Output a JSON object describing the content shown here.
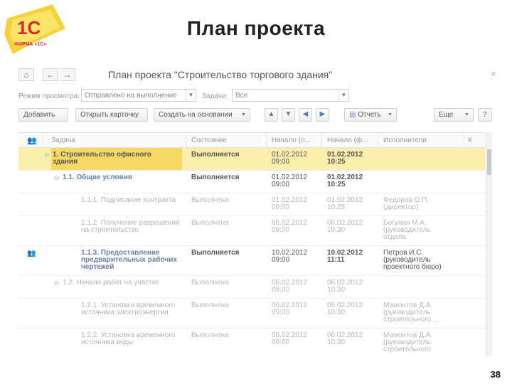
{
  "slide": {
    "title": "План проекта",
    "number": "38",
    "logo_text": "1С",
    "logo_sub": "ФИРМА «1С»"
  },
  "window": {
    "title": "План проекта \"Строительство торгового здания\""
  },
  "filters": {
    "mode_label": "Режим просмотра:",
    "mode_value": "Отправлено на выполнение",
    "tasks_label": "Задачи:",
    "tasks_value": "Все"
  },
  "toolbar": {
    "add": "Добавить",
    "open_card": "Открыть карточку",
    "create_based": "Создать на основании",
    "report": "Отчеть",
    "more": "Еще",
    "help": "?"
  },
  "columns": [
    "Задача",
    "Состояние",
    "Начало (п...",
    "Начало (ф...",
    "Исполнители",
    "К"
  ],
  "rows": [
    {
      "indent": 1,
      "tree": "⊖",
      "task": "1. Строительство офисного\nздания",
      "state": "Выполняется",
      "plan_start": "01.02.2012\n09:00",
      "fact_start": "01.02.2012\n10:25",
      "executor": "",
      "selected": true,
      "active": true,
      "user": false
    },
    {
      "indent": 2,
      "tree": "⊖",
      "task": "1.1. Общие условия",
      "state": "Выполняется",
      "plan_start": "01.02.2012\n09:00",
      "fact_start": "01.02.2012\n10:25",
      "executor": "",
      "selected": false,
      "active": true,
      "user": false
    },
    {
      "indent": 3,
      "tree": "",
      "task": "1.1.1. Подписание контракта",
      "state": "Выполнена",
      "plan_start": "01.02.2012\n09:00",
      "fact_start": "01.02.2012\n10:25",
      "executor": "Федоров О.П.\n(директор)",
      "selected": false,
      "active": false,
      "user": false
    },
    {
      "indent": 3,
      "tree": "",
      "task": "1.1.2. Получение разрешений\nна строительство",
      "state": "Выполнена",
      "plan_start": "06.02.2012\n09:00",
      "fact_start": "06.02.2012\n10:30",
      "executor": "Богунин М.А.\n(руководитель\nотдела",
      "selected": false,
      "active": false,
      "user": false
    },
    {
      "indent": 3,
      "tree": "",
      "task": "1.1.3. Предоставление\nпредварительных рабочих\nчертежей",
      "state": "Выполняется",
      "plan_start": "10.02.2012\n09:00",
      "fact_start": "10.02.2012\n11:11",
      "executor": "Петров И.С.\n(руководитель\nпроектного бюро)",
      "selected": false,
      "active": true,
      "user": true
    },
    {
      "indent": 2,
      "tree": "⊖",
      "task": "1.2. Начало работ на участке",
      "state": "Выполнена",
      "plan_start": "06.02.2012\n09:00",
      "fact_start": "06.02.2012\n10:30",
      "executor": "",
      "selected": false,
      "active": false,
      "user": false
    },
    {
      "indent": 3,
      "tree": "",
      "task": "1.2.1. Установка временного\nисточника электроэнергии",
      "state": "Выполнена",
      "plan_start": "06.02.2012\n09:00",
      "fact_start": "06.02.2012\n10:30",
      "executor": "Мамонтов Д.А.\n(руководитель\nстроительного ...",
      "selected": false,
      "active": false,
      "user": false
    },
    {
      "indent": 3,
      "tree": "",
      "task": "1.2.2. Установка временного\nисточника воды",
      "state": "Выполнена",
      "plan_start": "06.02.2012\n09:00",
      "fact_start": "06.02.2012\n10:30",
      "executor": "Мамонтов Д.А.\n(руководитель\nстроительного",
      "selected": false,
      "active": false,
      "user": false
    }
  ]
}
